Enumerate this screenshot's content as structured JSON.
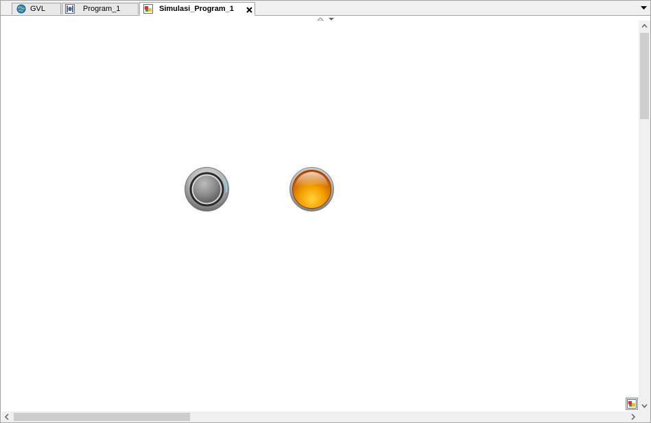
{
  "tabs": [
    {
      "label": "GVL",
      "icon": "gvl-globe-icon",
      "active": false
    },
    {
      "label": "Program_1",
      "icon": "program-ladder-icon",
      "active": false
    },
    {
      "label": "Simulasi_Program_1",
      "icon": "visualization-icon",
      "active": true
    }
  ],
  "canvas": {
    "elements": [
      {
        "type": "push-button",
        "color": "#8c8c8c"
      },
      {
        "type": "lamp",
        "color": "#f5a000"
      }
    ]
  },
  "colors": {
    "tab_border": "#a0a0a0",
    "tab_inactive_bg": "#e8e8e8",
    "scroll_thumb": "#cdcdcd",
    "lamp_orange": "#f5a000",
    "button_gray": "#8c8c8c"
  }
}
